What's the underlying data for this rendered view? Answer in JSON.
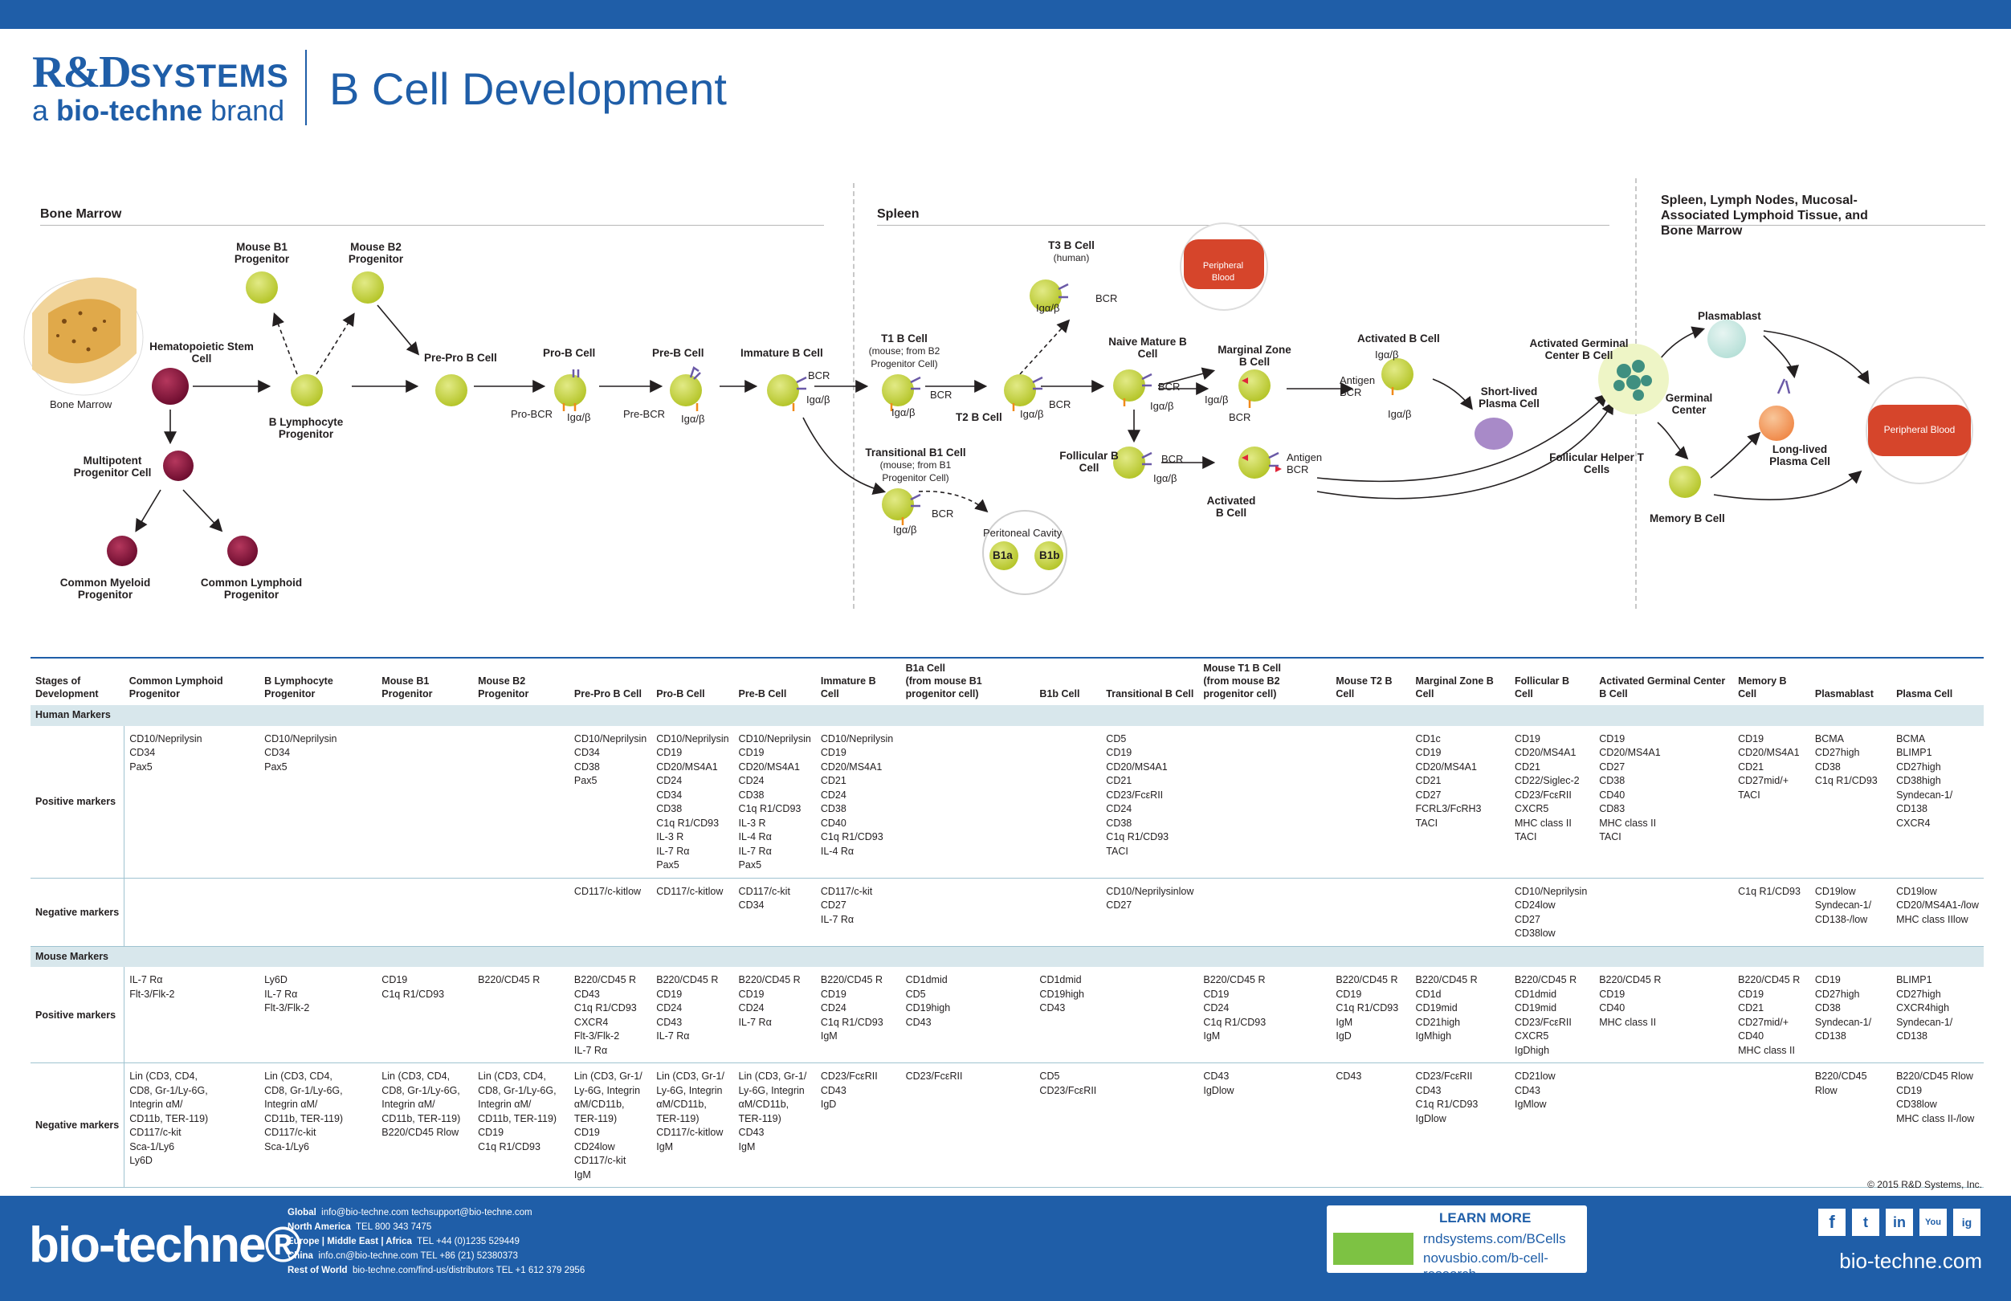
{
  "header": {
    "logo_rd": "R&D",
    "logo_systems": "SYSTEMS",
    "logo_brand_a": "a",
    "logo_brand_name": "bio-techne",
    "logo_brand_b": "brand",
    "title": "B Cell Development"
  },
  "sections": {
    "bone_marrow": "Bone Marrow",
    "spleen": "Spleen",
    "periphery": "Spleen, Lymph Nodes, Mucosal-Associated Lymphoid Tissue, and Bone Marrow"
  },
  "cells": {
    "bone_marrow_img": "Bone Marrow",
    "hsc": "Hematopoietic Stem Cell",
    "mpp": "Multipotent Progenitor Cell",
    "cmp": "Common Myeloid Progenitor",
    "clp": "Common Lymphoid Progenitor",
    "b_lymph_prog": "B Lymphocyte Progenitor",
    "mouse_b1": "Mouse B1 Progenitor",
    "mouse_b2": "Mouse B2 Progenitor",
    "prepro": "Pre-Pro B Cell",
    "prob": "Pro-B Cell",
    "preb": "Pre-B Cell",
    "immature": "Immature B Cell",
    "t1": "T1 B Cell",
    "t1_sub": "(mouse; from B2 Progenitor Cell)",
    "t2": "T2 B Cell",
    "t3": "T3 B Cell",
    "t3_sub": "(human)",
    "trans_b1": "Transitional B1 Cell",
    "trans_b1_sub": "(mouse; from B1 Progenitor Cell)",
    "peritoneal": "Peritoneal Cavity",
    "b1a": "B1a",
    "b1b": "B1b",
    "naive": "Naive Mature B Cell",
    "marginal": "Marginal Zone B Cell",
    "follicular": "Follicular B Cell",
    "activated": "Activated B Cell",
    "activated2": "Activated B Cell",
    "short_lived": "Short-lived Plasma Cell",
    "germinal_b": "Activated Germinal Center B Cell",
    "germinal_center": "Germinal Center",
    "tfh": "Follicular Helper T Cells",
    "plasmablast": "Plasmablast",
    "long_lived": "Long-lived Plasma Cell",
    "memory": "Memory B Cell",
    "peripheral_blood": "Peripheral Blood",
    "peripheral_blood2": "Peripheral Blood"
  },
  "small": {
    "pro_bcr": "Pro-BCR",
    "pre_bcr": "Pre-BCR",
    "ig": "Igα/β",
    "bcr": "BCR",
    "antigen": "Antigen",
    "antigen_bcr": "Antigen BCR"
  },
  "table": {
    "stage_label": "Stages of Development",
    "columns": [
      "Common Lymphoid Progenitor",
      "B Lymphocyte Progenitor",
      "Mouse B1 Progenitor",
      "Mouse B2 Progenitor",
      "Pre-Pro B Cell",
      "Pro-B Cell",
      "Pre-B Cell",
      "Immature B Cell",
      "B1a Cell",
      "B1b Cell",
      "Transitional B Cell",
      "Mouse T1 B Cell",
      "Mouse T2 B Cell",
      "Marginal Zone B Cell",
      "Follicular B Cell",
      "Activated Germinal Center B Cell",
      "Memory B Cell",
      "Plasmablast",
      "Plasma Cell"
    ],
    "b1_note": "(from mouse B1 progenitor cell)",
    "b2_note": "(from mouse B2 progenitor cell)",
    "human_band": "Human Markers",
    "mouse_band": "Mouse Markers",
    "pos_label": "Positive markers",
    "neg_label": "Negative markers",
    "human_pos": [
      "CD10/Neprilysin\nCD34\nPax5",
      "CD10/Neprilysin\nCD34\nPax5",
      "",
      "",
      "CD10/Neprilysin\nCD34\nCD38\nPax5",
      "CD10/Neprilysin\nCD19\nCD20/MS4A1\nCD24\nCD34\nCD38\nC1q R1/CD93\nIL-3 R\nIL-7 Rα\nPax5",
      "CD10/Neprilysin\nCD19\nCD20/MS4A1\nCD24\nCD38\nC1q R1/CD93\nIL-3 R\nIL-4 Rα\nIL-7 Rα\nPax5",
      "CD10/Neprilysin\nCD19\nCD20/MS4A1\nCD21\nCD24\nCD38\nCD40\nC1q R1/CD93\nIL-4 Rα",
      "",
      "",
      "CD5\nCD19\nCD20/MS4A1\nCD21\nCD23/FcεRII\nCD24\nCD38\nC1q R1/CD93\nTACI",
      "",
      "",
      "CD1c\nCD19\nCD20/MS4A1\nCD21\nCD27\nFCRL3/FcRH3\nTACI",
      "CD19\nCD20/MS4A1\nCD21\nCD22/Siglec-2\nCD23/FcεRII\nCXCR5\nMHC class II\nTACI",
      "CD19\nCD20/MS4A1\nCD27\nCD38\nCD40\nCD83\nMHC class II\nTACI",
      "CD19\nCD20/MS4A1\nCD21\nCD27mid/+\nTACI",
      "BCMA\nCD27high\nCD38\nC1q R1/CD93",
      "BCMA\nBLIMP1\nCD27high\nCD38high\nSyndecan-1/\nCD138\nCXCR4"
    ],
    "human_neg": [
      "",
      "",
      "",
      "",
      "CD117/c-kitlow",
      "CD117/c-kitlow",
      "CD117/c-kit\nCD34",
      "CD117/c-kit\nCD27\nIL-7 Rα",
      "",
      "",
      "CD10/Neprilysinlow\nCD27",
      "",
      "",
      "",
      "CD10/Neprilysin\nCD24low\nCD27\nCD38low",
      "",
      "C1q R1/CD93",
      "CD19low\nSyndecan-1/\nCD138-/low",
      "CD19low\nCD20/MS4A1-/low\nMHC class IIlow"
    ],
    "mouse_pos": [
      "IL-7 Rα\nFlt-3/Flk-2",
      "Ly6D\nIL-7 Rα\nFlt-3/Flk-2",
      "CD19\nC1q R1/CD93",
      "B220/CD45 R",
      "B220/CD45 R\nCD43\nC1q R1/CD93\nCXCR4\nFlt-3/Flk-2\nIL-7 Rα",
      "B220/CD45 R\nCD19\nCD24\nCD43\nIL-7 Rα",
      "B220/CD45 R\nCD19\nCD24\nIL-7 Rα",
      "B220/CD45 R\nCD19\nCD24\nC1q R1/CD93\nIgM",
      "CD1dmid\nCD5\nCD19high\nCD43",
      "CD1dmid\nCD19high\nCD43",
      "",
      "B220/CD45 R\nCD19\nCD24\nC1q R1/CD93\nIgM",
      "B220/CD45 R\nCD19\nC1q R1/CD93\nIgM\nIgD",
      "B220/CD45 R\nCD1d\nCD19mid\nCD21high\nIgMhigh",
      "B220/CD45 R\nCD1dmid\nCD19mid\nCD23/FcεRII\nCXCR5\nIgDhigh",
      "B220/CD45 R\nCD19\nCD40\nMHC class II",
      "B220/CD45 R\nCD19\nCD21\nCD27mid/+\nCD40\nMHC class II",
      "CD19\nCD27high\nCD38\nSyndecan-1/\nCD138",
      "BLIMP1\nCD27high\nCXCR4high\nSyndecan-1/\nCD138"
    ],
    "mouse_neg": [
      "Lin (CD3, CD4,\nCD8, Gr-1/Ly-6G,\nIntegrin αM/\nCD11b, TER-119)\nCD117/c-kit\nSca-1/Ly6\nLy6D",
      "Lin (CD3, CD4,\nCD8, Gr-1/Ly-6G,\nIntegrin αM/\nCD11b, TER-119)\nCD117/c-kit\nSca-1/Ly6",
      "Lin (CD3, CD4,\nCD8, Gr-1/Ly-6G,\nIntegrin αM/\nCD11b, TER-119)\nB220/CD45 Rlow",
      "Lin (CD3, CD4,\nCD8, Gr-1/Ly-6G,\nIntegrin αM/\nCD11b, TER-119)\nCD19\nC1q R1/CD93",
      "Lin (CD3, Gr-1/\nLy-6G, Integrin\nαM/CD11b,\nTER-119)\nCD19\nCD24low\nCD117/c-kit\nIgM",
      "Lin (CD3, Gr-1/\nLy-6G, Integrin\nαM/CD11b,\nTER-119)\nCD117/c-kitlow\nIgM",
      "Lin (CD3, Gr-1/\nLy-6G, Integrin\nαM/CD11b,\nTER-119)\nCD43\nIgM",
      "CD23/FcεRII\nCD43\nIgD",
      "CD23/FcεRII",
      "CD5\nCD23/FcεRII",
      "",
      "CD43\nIgDlow",
      "CD43",
      "CD23/FcεRII\nCD43\nC1q R1/CD93\nIgDlow",
      "CD21low\nCD43\nIgMlow",
      "",
      "",
      "B220/CD45 Rlow",
      "B220/CD45 Rlow\nCD19\nCD38low\nMHC class II-/low"
    ]
  },
  "copyright": "© 2015 R&D Systems, Inc.",
  "footer": {
    "logo": "bio-techne®",
    "contacts": [
      {
        "k": "Global",
        "v": "info@bio-techne.com   techsupport@bio-techne.com"
      },
      {
        "k": "North America",
        "v": "TEL 800 343 7475"
      },
      {
        "k": "Europe | Middle East | Africa",
        "v": "TEL +44 (0)1235 529449"
      },
      {
        "k": "China",
        "v": "info.cn@bio-techne.com   TEL +86 (21) 52380373"
      },
      {
        "k": "Rest of World",
        "v": "bio-techne.com/find-us/distributors   TEL +1 612 379 2956"
      }
    ],
    "learn_more": "LEARN MORE",
    "link1": "rndsystems.com/BCells",
    "link2": "novusbio.com/b-cell-research",
    "url": "bio-techne.com",
    "social": [
      "f",
      "t",
      "in",
      "You",
      "ig"
    ]
  },
  "colors": {
    "brand": "#1f5ea8",
    "b_cell": "#c5d43b",
    "stem": "#7a1035",
    "plasma": "#a88ac8",
    "blood": "#d6452b",
    "band": "#d8e7ec"
  }
}
